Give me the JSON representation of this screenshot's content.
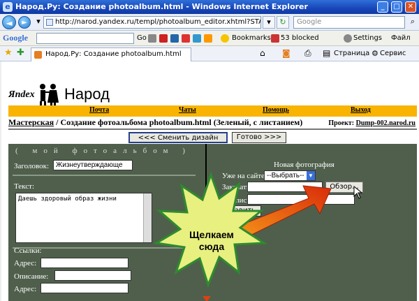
{
  "window": {
    "title": "Народ.Ру: Создание photoalbum.html - Windows Internet Explorer"
  },
  "addressbar": {
    "url": "http://narod.yandex.ru/templ/photoalbum_editor.xhtml?STATUS=NEW&filena",
    "search_placeholder": "Google"
  },
  "google_toolbar": {
    "logo": "Google",
    "go": "Go",
    "bookmarks": "Bookmarks",
    "blocked": "53 blocked",
    "settings": "Settings",
    "file": "Файл"
  },
  "favorites_bar": {
    "tab_title": "Народ.Ру: Создание photoalbum.html",
    "page_menu": "Страница",
    "service_menu": "Сервис"
  },
  "site": {
    "logo_yandex": "Яndex",
    "logo_narod": "Народ",
    "nav": [
      "Почта",
      "Чаты",
      "Помощь",
      "Выход"
    ],
    "breadcrumb_link": "Мастерская",
    "breadcrumb_rest": " / Создание фотоальбома photoalbum.html (Зеленый, с листанием)",
    "project_label": "Проект:",
    "project_value": "Dump-002.narod.ru",
    "change_design": "<<< Сменить дизайн",
    "done": "Готово >>>"
  },
  "editor": {
    "album_title": "( мой фотоальбом )",
    "heading_label": "Заголовок:",
    "heading_value": "Жизнеутверждающе",
    "text_label": "Текст:",
    "text_value": "Даешь здоровый образ жизни",
    "links_label": "Ссылки:",
    "address_label": "Адрес:",
    "description_label": "Описание:",
    "address2_label": "Адрес:",
    "new_photo": "Новая фотография",
    "on_site_label": "Уже на сайте:",
    "select_value": "--Выбрать--",
    "upload_label": "Закачать:",
    "browse_button": "Обзор...",
    "caption_label": "Подпись:",
    "add_button": "Добавить"
  },
  "annotation": {
    "text": "Щелкаем сюда",
    "burst_color": "#2e8b2e",
    "burst_fill": "#e8f080",
    "arrow_color": "#e04010"
  }
}
